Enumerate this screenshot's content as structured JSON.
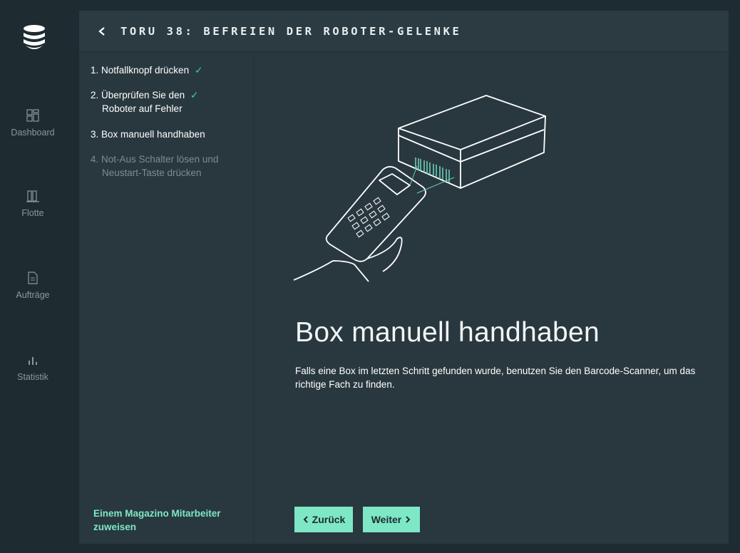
{
  "nav": {
    "items": [
      {
        "label": "Dashboard",
        "icon": "dashboard-icon"
      },
      {
        "label": "Flotte",
        "icon": "fleet-icon"
      },
      {
        "label": "Aufträge",
        "icon": "orders-icon"
      },
      {
        "label": "Statistik",
        "icon": "statistics-icon"
      }
    ]
  },
  "header": {
    "title": "TORU 38: BEFREIEN DER ROBOTER-GELENKE"
  },
  "steps": [
    {
      "line1": "1. Notfallknopf drücken",
      "line2": "",
      "done": true
    },
    {
      "line1": "2. Überprüfen Sie den",
      "line2": "Roboter auf Fehler",
      "done": true
    },
    {
      "line1": "3. Box manuell handhaben",
      "line2": "",
      "done": false
    },
    {
      "line1": "4. Not-Aus Schalter lösen und",
      "line2": "Neustart-Taste drücken",
      "done": false
    }
  ],
  "check_mark": "✓",
  "assign_link": "Einem Magazino Mitarbeiter zuweisen",
  "content": {
    "heading": "Box manuell handhaben",
    "description": "Falls eine Box im letzten Schritt gefunden wurde, benutzen Sie den Barcode-Scanner, um das richtige Fach zu finden."
  },
  "buttons": {
    "back": "Zurück",
    "next": "Weiter"
  },
  "colors": {
    "accent": "#7ee8c6",
    "check": "#3ddc97",
    "panel": "#29383e",
    "background": "#1e2b30"
  }
}
